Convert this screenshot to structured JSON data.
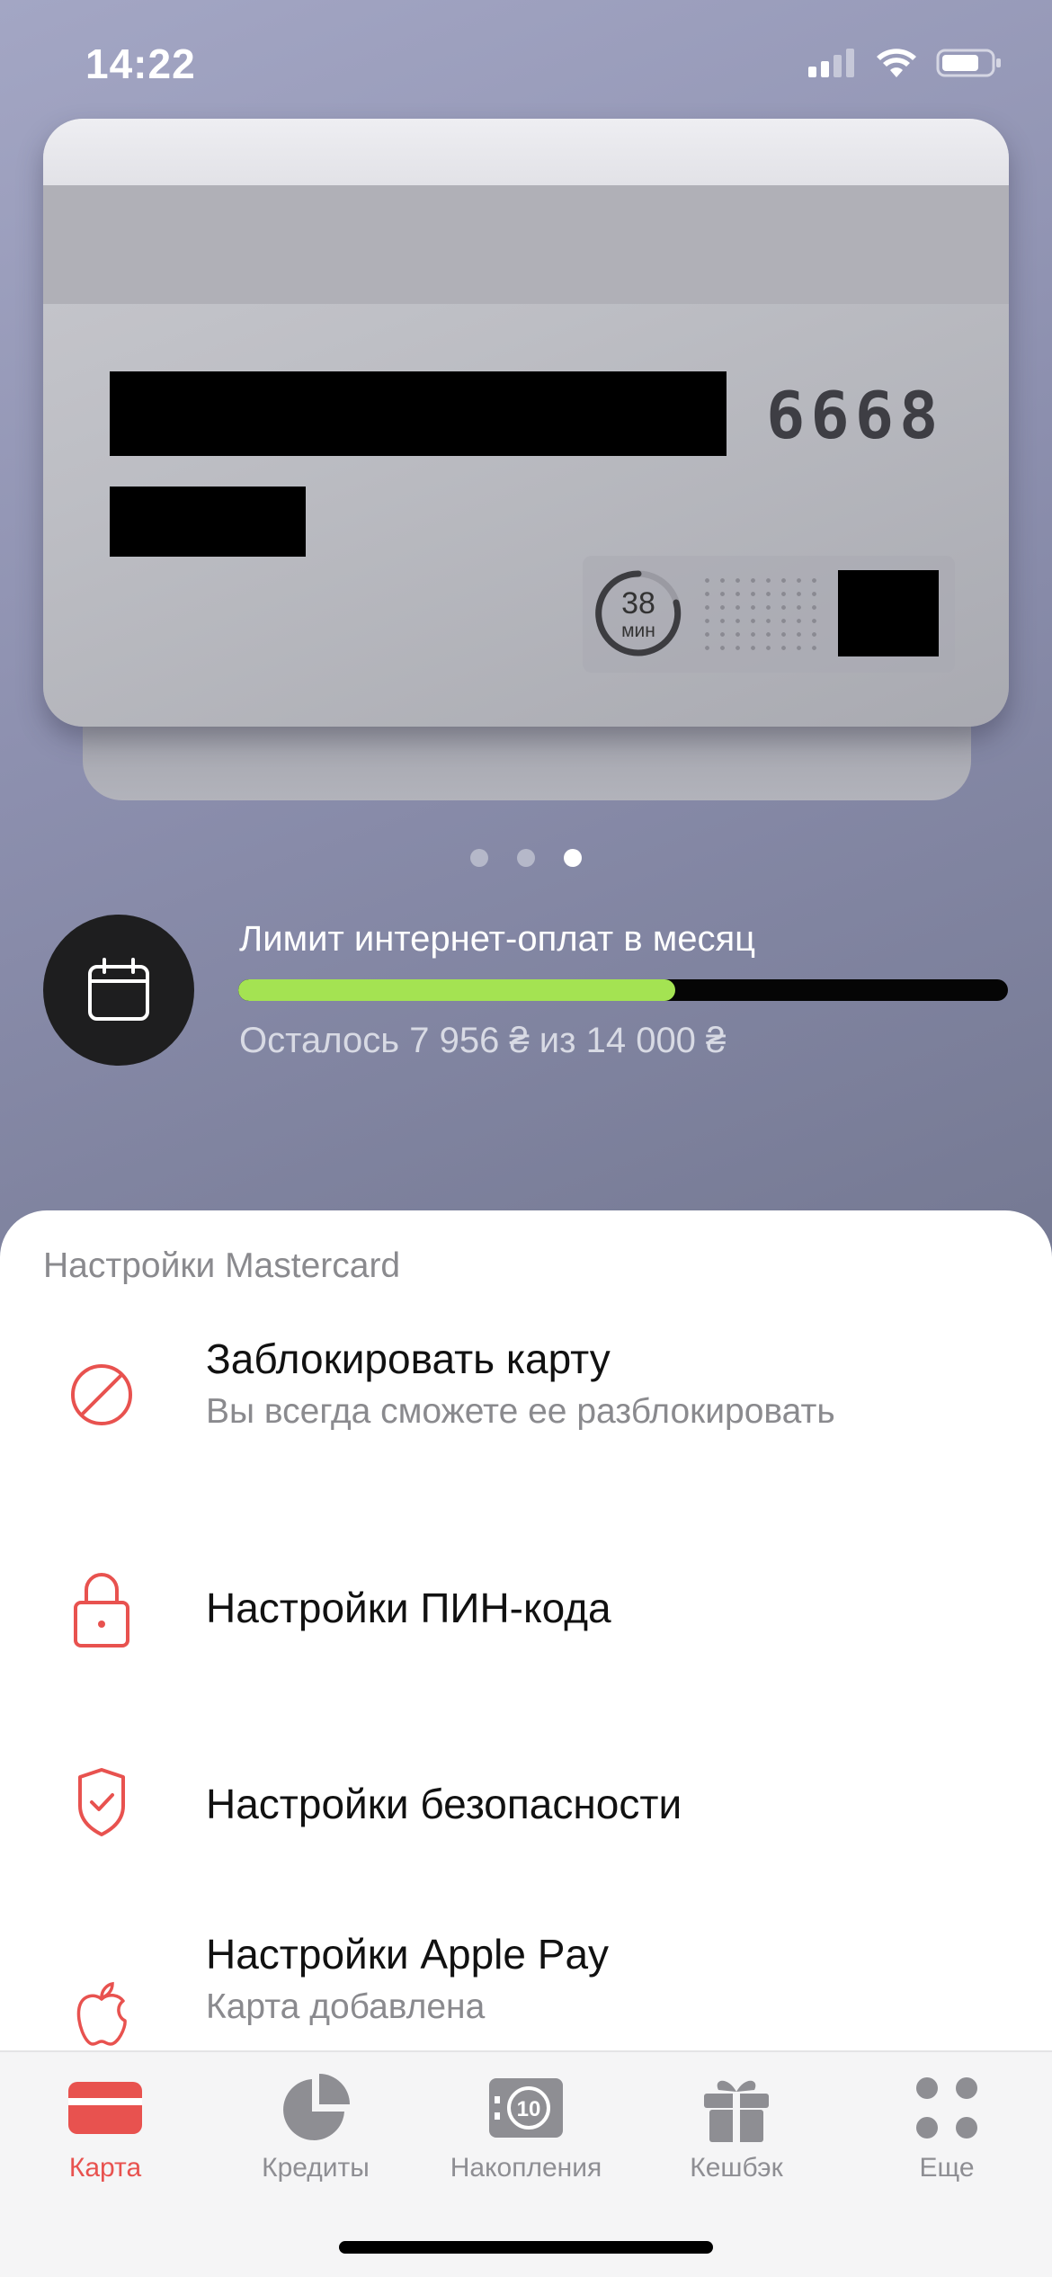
{
  "status_bar": {
    "time": "14:22"
  },
  "card": {
    "last4": "6668",
    "timer_value": "38",
    "timer_unit": "мин"
  },
  "pager": {
    "count": 3,
    "active_index": 2
  },
  "limit": {
    "title": "Лимит интернет-оплат в месяц",
    "remaining_text": "Осталось 7 956 ₴ из 14 000 ₴",
    "remaining": 7956,
    "total": 14000,
    "bar_fill_fraction": 0.568,
    "fill_color": "#a4e352"
  },
  "settings": {
    "header": "Настройки Mastercard",
    "items": [
      {
        "icon": "block-icon",
        "title": "Заблокировать карту",
        "subtitle": "Вы всегда сможете ее разблокировать"
      },
      {
        "icon": "lock-icon",
        "title": "Настройки ПИН-кода"
      },
      {
        "icon": "shield-icon",
        "title": "Настройки безопасности"
      },
      {
        "icon": "apple-icon",
        "title": "Настройки Apple Pay",
        "subtitle": "Карта добавлена"
      }
    ]
  },
  "tabbar": {
    "active_color": "#e8524f",
    "items": [
      {
        "label": "Карта",
        "icon": "card-icon",
        "active": true
      },
      {
        "label": "Кредиты",
        "icon": "pie-chart-icon",
        "active": false
      },
      {
        "label": "Накопления",
        "icon": "savings-icon",
        "active": false
      },
      {
        "label": "Кешбэк",
        "icon": "gift-icon",
        "active": false
      },
      {
        "label": "Еще",
        "icon": "more-grid-icon",
        "active": false
      }
    ]
  }
}
